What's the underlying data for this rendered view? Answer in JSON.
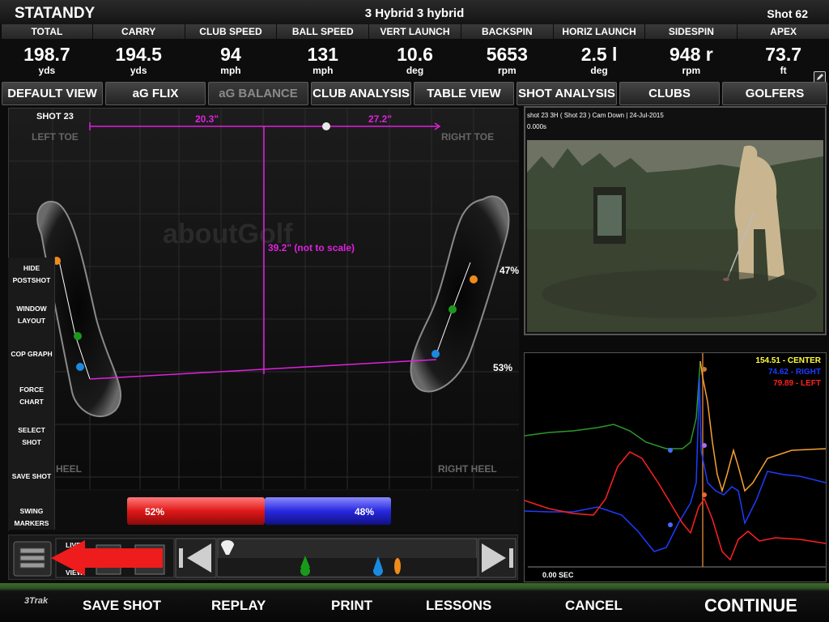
{
  "header": {
    "player": "STATANDY",
    "club": "3 Hybrid 3 hybrid",
    "shot": "Shot 62"
  },
  "stats": [
    {
      "label": "TOTAL",
      "value": "198.7",
      "unit": "yds"
    },
    {
      "label": "CARRY",
      "value": "194.5",
      "unit": "yds"
    },
    {
      "label": "CLUB SPEED",
      "value": "94",
      "unit": "mph"
    },
    {
      "label": "BALL SPEED",
      "value": "131",
      "unit": "mph"
    },
    {
      "label": "VERT LAUNCH",
      "value": "10.6",
      "unit": "deg"
    },
    {
      "label": "BACKSPIN",
      "value": "5653",
      "unit": "rpm"
    },
    {
      "label": "HORIZ LAUNCH",
      "value": "2.5 l",
      "unit": "deg"
    },
    {
      "label": "SIDESPIN",
      "value": "948 r",
      "unit": "rpm"
    },
    {
      "label": "APEX",
      "value": "73.7",
      "unit": "ft"
    }
  ],
  "tabs": [
    {
      "label": "DEFAULT VIEW",
      "disabled": false
    },
    {
      "label": "aG FLIX",
      "disabled": false
    },
    {
      "label": "aG BALANCE",
      "disabled": true
    },
    {
      "label": "CLUB ANALYSIS",
      "disabled": false
    },
    {
      "label": "TABLE VIEW",
      "disabled": false
    },
    {
      "label": "SHOT ANALYSIS",
      "disabled": false
    },
    {
      "label": "CLUBS",
      "disabled": false
    },
    {
      "label": "GOLFERS",
      "disabled": false
    }
  ],
  "balance": {
    "shot_label": "SHOT 23",
    "left_toe": "LEFT TOE",
    "right_toe": "RIGHT TOE",
    "left_heel": "HEEL",
    "right_heel": "RIGHT HEEL",
    "dist_left": "20.3\"",
    "dist_right": "27.2\"",
    "stance_width": "39.2\" (not to scale)",
    "right_toe_pct": "47%",
    "right_heel_pct": "53%",
    "left_pct_label": "52%",
    "right_pct_label": "48%",
    "left_weight": 0.52,
    "watermark": "aboutGolf"
  },
  "menu": [
    {
      "line1": "HIDE",
      "line2": "POSTSHOT"
    },
    {
      "line1": "WINDOW",
      "line2": "LAYOUT"
    },
    {
      "line1": "COP GRAPH",
      "line2": ""
    },
    {
      "line1": "FORCE",
      "line2": "CHART"
    },
    {
      "line1": "SELECT",
      "line2": "SHOT"
    },
    {
      "line1": "SAVE SHOT",
      "line2": ""
    },
    {
      "line1": "SWING",
      "line2": "MARKERS"
    }
  ],
  "playback": {
    "live_line1": "LIVE",
    "live_line2": "VIEW"
  },
  "video": {
    "caption": "shot 23 3H ( Shot 23 ) Cam Down  |  24-Jul-2015",
    "time": "0.000s"
  },
  "graph": {
    "center": "154.51 - CENTER",
    "right": "74.62 - RIGHT",
    "left": "79.89 - LEFT",
    "time": "0.00 SEC",
    "colors": {
      "center": "#f7a033",
      "right": "#1e3cff",
      "left": "#ff2020",
      "green": "#2a9a2a"
    }
  },
  "footer": {
    "logo": "3Trak",
    "save": "SAVE SHOT",
    "replay": "REPLAY",
    "print": "PRINT",
    "lessons": "LESSONS",
    "cancel": "CANCEL",
    "continue": "CONTINUE"
  }
}
